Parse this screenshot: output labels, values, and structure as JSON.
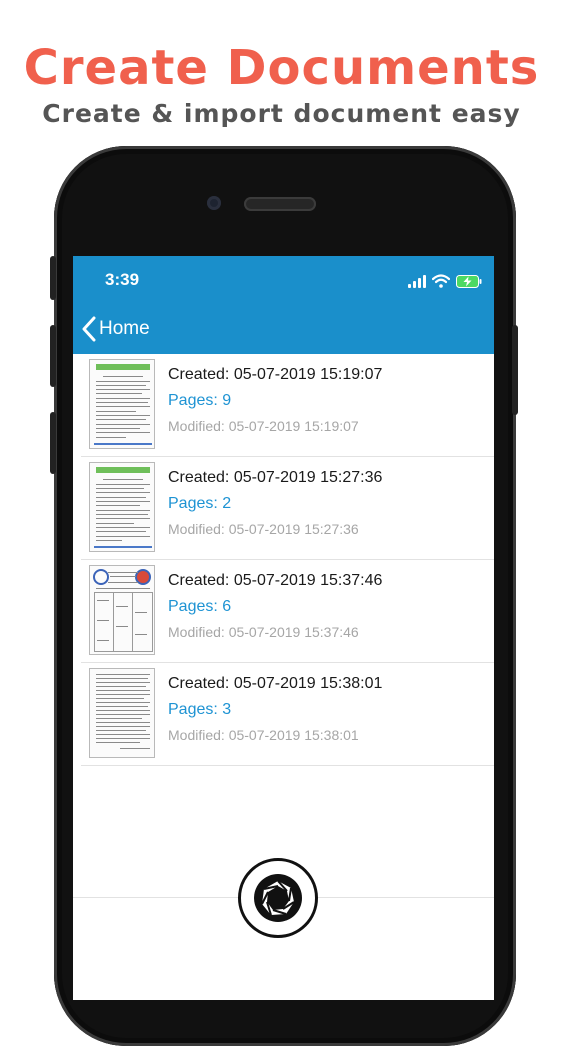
{
  "promo": {
    "title": "Create Documents",
    "subtitle": "Create & import document easy"
  },
  "status_bar": {
    "time": "3:39"
  },
  "nav": {
    "back_label": "Home"
  },
  "documents": [
    {
      "created": "Created: 05-07-2019 15:19:07",
      "pages": "Pages: 9",
      "modified": "Modified: 05-07-2019 15:19:07"
    },
    {
      "created": "Created: 05-07-2019 15:27:36",
      "pages": "Pages: 2",
      "modified": "Modified: 05-07-2019 15:27:36"
    },
    {
      "created": "Created: 05-07-2019 15:37:46",
      "pages": "Pages: 6",
      "modified": "Modified: 05-07-2019 15:37:46"
    },
    {
      "created": "Created: 05-07-2019 15:38:01",
      "pages": "Pages: 3",
      "modified": "Modified: 05-07-2019 15:38:01"
    }
  ],
  "icons": {
    "back": "chevron-left-icon",
    "signal": "cellular-signal-icon",
    "wifi": "wifi-icon",
    "battery": "battery-charging-icon",
    "capture": "camera-shutter-icon"
  },
  "colors": {
    "title": "#f0604d",
    "subtitle": "#555555",
    "navbar": "#1a8fcb",
    "pages_text": "#1e93d3",
    "modified_text": "#a6a6a6",
    "battery": "#4cd964"
  }
}
